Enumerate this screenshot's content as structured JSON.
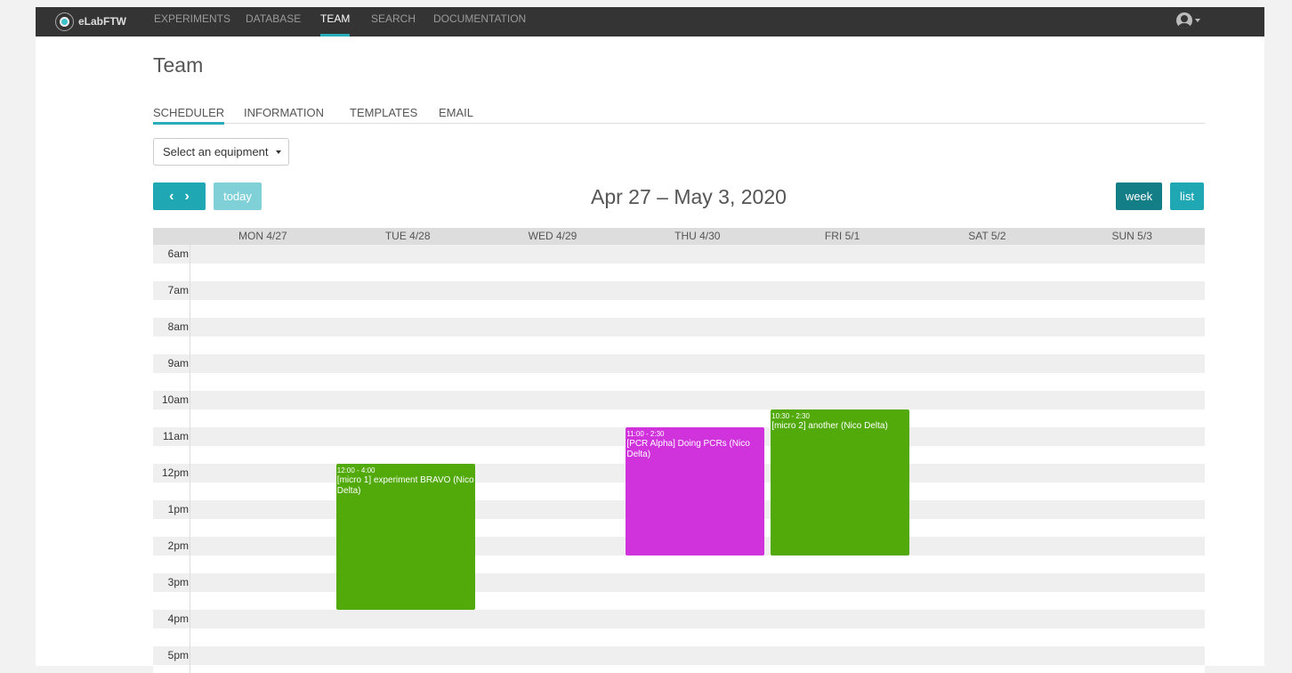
{
  "app": {
    "name": "eLabFTW"
  },
  "nav": {
    "items": [
      "EXPERIMENTS",
      "DATABASE",
      "TEAM",
      "SEARCH",
      "DOCUMENTATION"
    ],
    "active": "TEAM"
  },
  "page": {
    "title": "Team"
  },
  "tabs": {
    "items": [
      "SCHEDULER",
      "INFORMATION",
      "TEMPLATES",
      "EMAIL"
    ],
    "active": "SCHEDULER"
  },
  "equipment_select": {
    "label": "Select an equipment"
  },
  "calendar": {
    "title": "Apr 27 – May 3, 2020",
    "today_label": "today",
    "prev_label": "‹",
    "next_label": "›",
    "week_label": "week",
    "list_label": "list",
    "days": [
      "MON 4/27",
      "TUE 4/28",
      "WED 4/29",
      "THU 4/30",
      "FRI 5/1",
      "SAT 5/2",
      "SUN 5/3"
    ],
    "hours": [
      "6am",
      "7am",
      "8am",
      "9am",
      "10am",
      "11am",
      "12pm",
      "1pm",
      "2pm",
      "3pm",
      "4pm",
      "5pm"
    ],
    "events": [
      {
        "day": "TUE 4/28",
        "time": "12:00 - 4:00",
        "title": "[micro 1] experiment BRAVO (Nico Delta)",
        "color": "#51aa0a",
        "start": 12.0,
        "end": 16.0
      },
      {
        "day": "THU 4/30",
        "time": "11:00 - 2:30",
        "title": "[PCR Alpha] Doing PCRs (Nico Delta)",
        "color": "#d032dc",
        "start": 11.0,
        "end": 14.5
      },
      {
        "day": "FRI 5/1",
        "time": "10:30 - 2:30",
        "title": "[micro 2] another (Nico Delta)",
        "color": "#51aa0a",
        "start": 10.5,
        "end": 14.5
      }
    ]
  },
  "colors": {
    "accent": "#29aeb9",
    "navbar": "#343434",
    "week_button": "#147e86"
  }
}
